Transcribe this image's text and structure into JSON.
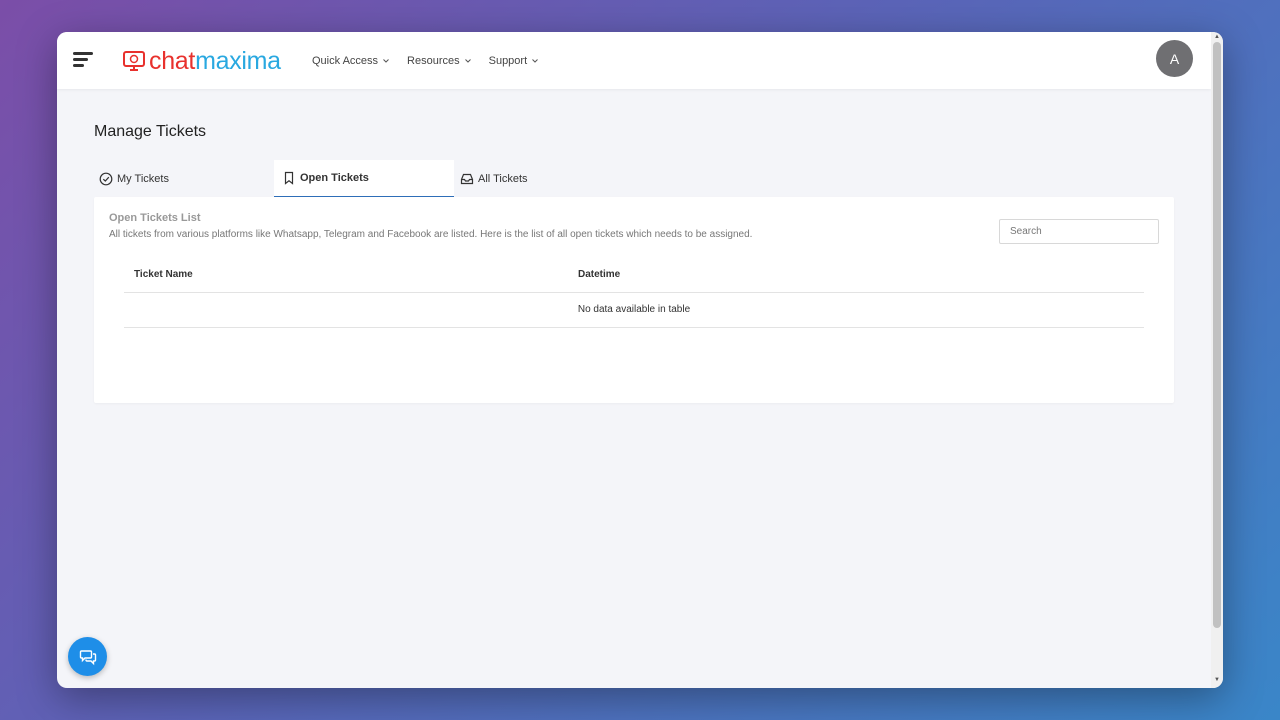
{
  "app": {
    "logo_chat": "chat",
    "logo_maxima": "maxima",
    "brand_colors": {
      "red": "#e8312d",
      "blue": "#29a8e0",
      "accent": "#1e8ee8"
    }
  },
  "nav": {
    "items": [
      {
        "label": "Quick Access",
        "icon": "chevron-down-icon"
      },
      {
        "label": "Resources",
        "icon": "chevron-down-icon"
      },
      {
        "label": "Support",
        "icon": "chevron-down-icon"
      }
    ]
  },
  "user": {
    "avatar_letter": "A"
  },
  "page": {
    "title": "Manage Tickets"
  },
  "tabs": [
    {
      "label": "My Tickets",
      "icon": "check-circle-icon",
      "active": false
    },
    {
      "label": "Open Tickets",
      "icon": "bookmark-icon",
      "active": true
    },
    {
      "label": "All Tickets",
      "icon": "inbox-icon",
      "active": false
    }
  ],
  "card": {
    "title": "Open Tickets List",
    "description": "All tickets from various platforms like Whatsapp, Telegram and Facebook are listed. Here is the list of all open tickets which needs to be assigned.",
    "search_placeholder": "Search"
  },
  "table": {
    "columns": [
      "Ticket Name",
      "Datetime"
    ],
    "empty_message": "No data available in table"
  },
  "widgets": {
    "chat_button_icon": "chat-bubbles-icon"
  }
}
